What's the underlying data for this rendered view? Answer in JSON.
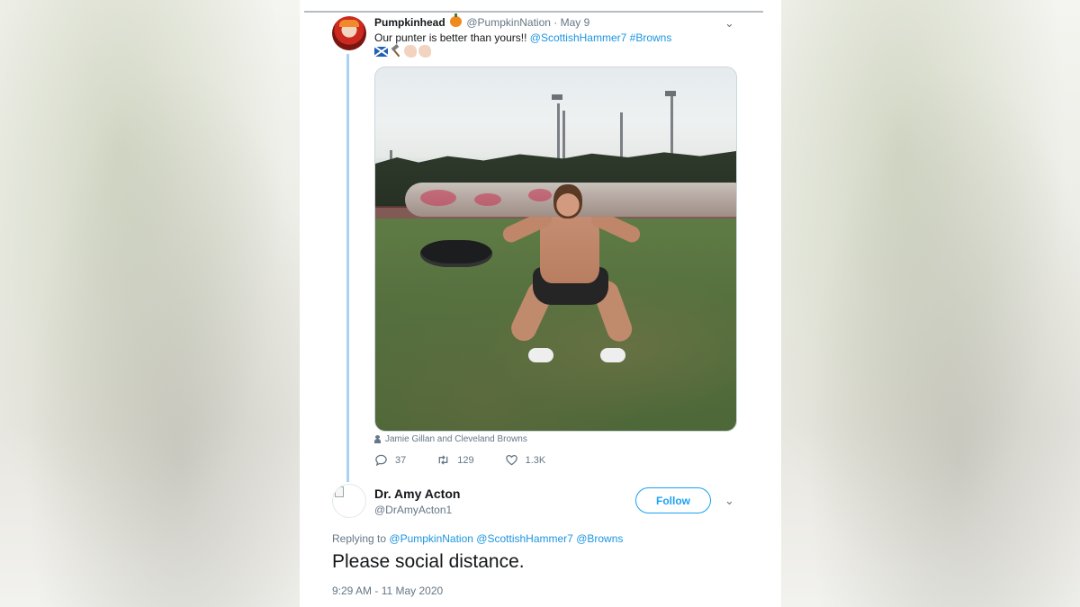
{
  "tweet": {
    "display_name": "Pumpkinhead",
    "handle": "@PumpkinNation",
    "separator": "·",
    "date": "May 9",
    "text_main": "Our punter is better than yours!!",
    "mention": "@ScottishHammer7",
    "hashtag": "#Browns",
    "emojis": [
      "scotland-flag",
      "hammer",
      "flexed-biceps",
      "flexed-biceps"
    ],
    "media_credit": "Jamie Gillan and Cleveland Browns",
    "stats": {
      "replies": "37",
      "retweets": "129",
      "likes": "1.3K"
    }
  },
  "reply": {
    "display_name": "Dr. Amy Acton",
    "handle": "@DrAmyActon1",
    "follow_label": "Follow",
    "replying_prefix": "Replying to",
    "replying_to": [
      "@PumpkinNation",
      "@ScottishHammer7",
      "@Browns"
    ],
    "text": "Please social distance.",
    "timestamp": "9:29 AM - 11 May 2020"
  },
  "colors": {
    "link": "#1b95e0",
    "thread_line": "#a9d3f5",
    "secondary_text": "#657786",
    "follow": "#1da1f2"
  }
}
